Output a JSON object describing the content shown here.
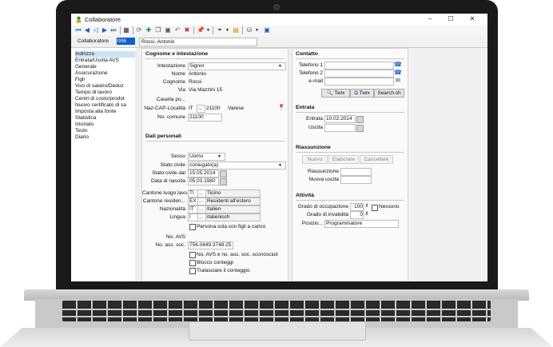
{
  "window": {
    "title": "Collaboratore",
    "controls": {
      "minimize": "–",
      "maximize": "☐",
      "close": "✕"
    }
  },
  "record": {
    "label": "Collaboratore",
    "number": "006",
    "name": "Rossi, Antonio"
  },
  "sidebar": {
    "items": [
      {
        "label": "Indirizzo",
        "selected": true,
        "expandable": false
      },
      {
        "label": "Entrata/Uscita AVS",
        "selected": false,
        "expandable": false
      },
      {
        "label": "Generale",
        "selected": false,
        "expandable": false
      },
      {
        "label": "Assicurazione",
        "selected": false,
        "expandable": false
      },
      {
        "label": "Figli",
        "selected": false,
        "expandable": false
      },
      {
        "label": "Voci di salario/Deduz",
        "selected": false,
        "expandable": false
      },
      {
        "label": "Tempo di lavoro",
        "selected": false,
        "expandable": false
      },
      {
        "label": "Centri di costo/prodot",
        "selected": false,
        "expandable": false
      },
      {
        "label": "Nuovo certificato di sa",
        "selected": false,
        "expandable": true
      },
      {
        "label": "Imposta alla fonte",
        "selected": false,
        "expandable": true
      },
      {
        "label": "Statistica",
        "selected": false,
        "expandable": false
      },
      {
        "label": "Istoriato",
        "selected": false,
        "expandable": false
      },
      {
        "label": "Testo",
        "selected": false,
        "expandable": false
      },
      {
        "label": "Diario",
        "selected": false,
        "expandable": false
      }
    ]
  },
  "name_section": {
    "title": "Cognome e intestazione",
    "intestazione": {
      "label": "Intestazione",
      "value": "Signor"
    },
    "nome": {
      "label": "Nome",
      "value": "Antonio"
    },
    "cognome": {
      "label": "Cognome",
      "value": "Rossi"
    },
    "via": {
      "label": "Via",
      "value": "Via Mazzini 15"
    },
    "casella": {
      "label": "Casella po...",
      "value": ""
    },
    "naz_cap": {
      "label": "Naz-CAP-Località",
      "naz": "IT",
      "dots": "...",
      "cap": "21100",
      "localita": "Varese"
    },
    "comune": {
      "label": "No. comune",
      "value": "21100"
    }
  },
  "personal": {
    "title": "Dati personali",
    "sesso": {
      "label": "Sesso",
      "value": "Uomo"
    },
    "stato_civile": {
      "label": "Stato civile",
      "value": "coniugato(a)"
    },
    "stato_civile_dal": {
      "label": "Stato civile dal",
      "value": "15.05.2014"
    },
    "data_nascita": {
      "label": "Data di nascita",
      "value": "05.03.1980"
    },
    "cantone_luogo": {
      "label": "Cantone luogo lavo...",
      "code": "TI",
      "dots": "...",
      "value": "Ticino"
    },
    "cantone_residenza": {
      "label": "Cantone residen...",
      "code": "EX",
      "dots": "...",
      "value": "Residenti all'estero"
    },
    "nazionalita": {
      "label": "Nazionalità",
      "code": "IT",
      "dots": "...",
      "value": "Italien"
    },
    "lingua": {
      "label": "Lingua",
      "code": "I",
      "dots": "...",
      "value": "italienisch"
    },
    "persona_sola": "Persona sola con figli a carico",
    "no_avs": {
      "label": "No. AVS",
      "value": ""
    },
    "no_ass_soc": {
      "label": "No. ass. soc.",
      "value": "756.0449.3748.25"
    },
    "check_sconosciuti": "No. AVS e no. ass. soc. sconosciuti",
    "check_blocco": "Blocco conteggi",
    "check_tralasciare": "Tralasciare il conteggio"
  },
  "contatto": {
    "title": "Contatto",
    "telefono1": {
      "label": "Telefono 1",
      "value": ""
    },
    "telefono2": {
      "label": "Telefono 2",
      "value": ""
    },
    "email": {
      "label": "e-mail",
      "value": ""
    },
    "btn_twix1": "Twix",
    "btn_twix2": "Twix",
    "btn_search": "Search.ch"
  },
  "entrata": {
    "title": "Entrata",
    "entrata": {
      "label": "Entrata",
      "value": "10.02.2014"
    },
    "uscita": {
      "label": "Uscita",
      "value": ""
    }
  },
  "riassunzione": {
    "title": "Riassunzione",
    "btn_nuovo": "Nuovo",
    "btn_elaborare": "Elaborare",
    "btn_cancellare": "Cancellare",
    "riassunzione": {
      "label": "Riassunzione",
      "value": ""
    },
    "nuova_uscita": {
      "label": "Nuova uscita",
      "value": ""
    }
  },
  "attivita": {
    "title": "Attività",
    "grado_occupazione": {
      "label": "Grado di occupazione",
      "value": "100"
    },
    "nessuno": "Nessuno",
    "grado_invalidita": {
      "label": "Grado di invalidità",
      "value": "0"
    },
    "posizione": {
      "label": "Posizio...",
      "value": "Programmatore"
    }
  },
  "colors": {
    "selection": "#0f5fc8",
    "sidebar_selected": "#cce4f7",
    "icon_blue": "#1f5fbf",
    "icon_green": "#2a8a2a"
  }
}
